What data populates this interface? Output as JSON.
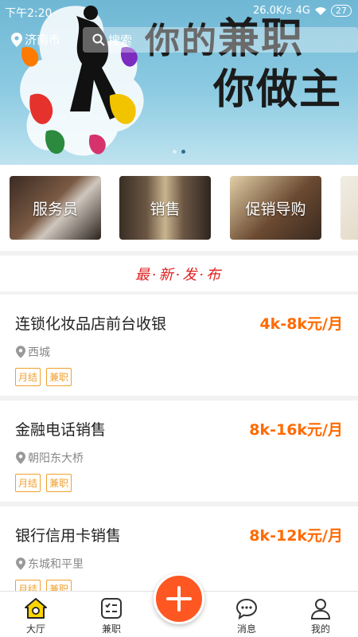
{
  "status": {
    "time": "下午2:20",
    "speed": "26.0K/s",
    "network": "4G",
    "battery": "27"
  },
  "location": {
    "city": "济南市"
  },
  "search": {
    "placeholder": "搜索"
  },
  "banner": {
    "line1_prefix": "你的",
    "line1_emphasis": "兼职",
    "line2": "你做主",
    "slides": 2,
    "active_slide": 2
  },
  "categories": [
    {
      "label": "服务员"
    },
    {
      "label": "销售"
    },
    {
      "label": "促销导购"
    },
    {
      "label": ""
    }
  ],
  "section": {
    "title": "最·新·发·布"
  },
  "jobs": [
    {
      "title": "连锁化妆品店前台收银",
      "salary": "4k-8k元/月",
      "location": "西城",
      "tags": [
        "月结",
        "兼职"
      ]
    },
    {
      "title": "金融电话销售",
      "salary": "8k-16k元/月",
      "location": "朝阳东大桥",
      "tags": [
        "月结",
        "兼职"
      ]
    },
    {
      "title": "银行信用卡销售",
      "salary": "8k-12k元/月",
      "location": "东城和平里",
      "tags": [
        "月结",
        "兼职"
      ]
    }
  ],
  "tabbar": {
    "home": "大厅",
    "jobs": "兼职",
    "messages": "消息",
    "mine": "我的"
  },
  "colors": {
    "accent": "#ff6a00",
    "fab": "#ff5722",
    "section_title": "#e02020",
    "tag": "#f0a030"
  }
}
